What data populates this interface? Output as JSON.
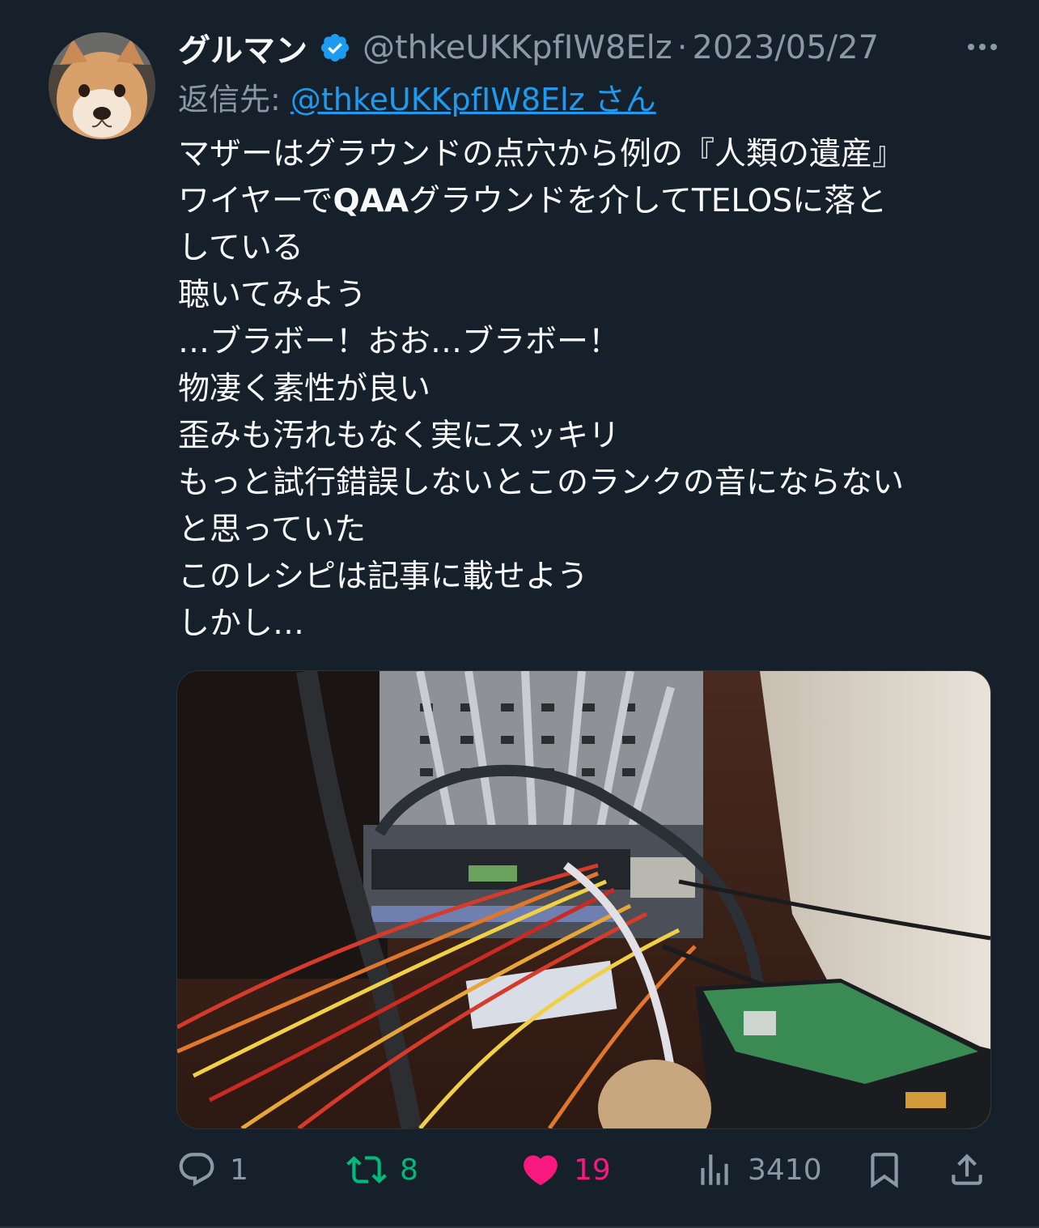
{
  "tweet": {
    "display_name": "グルマン",
    "handle": "@thkeUKKpfIW8Elz",
    "separator": "·",
    "date": "2023/05/27",
    "reply_prefix": "返信先: ",
    "reply_handle": "@thkeUKKpfIW8Elz さん",
    "lines": {
      "l1": "マザーはグラウンドの点穴から例の『人類の遺産』",
      "l2a": "ワイヤーで",
      "l2b": "QAA",
      "l2c": "グラウンドを介して",
      "l2d": "TELOS",
      "l2e": "に落と",
      "l3": "している",
      "l4": "聴いてみよう",
      "l5": "…ブラボー！おお…ブラボー！",
      "l6": "物凄く素性が良い",
      "l7": "歪みも汚れもなく実にスッキリ",
      "l8": "もっと試行錯誤しないとこのランクの音にならない",
      "l9": "と思っていた",
      "l10": "このレシピは記事に載せよう",
      "l11": "しかし…"
    }
  },
  "actions": {
    "replies": "1",
    "retweets": "8",
    "likes": "19",
    "views": "3410"
  },
  "colors": {
    "background": "#15202b",
    "text": "#f7f9f9",
    "muted": "#8b98a5",
    "link": "#1d9bf0",
    "retweet": "#00ba7c",
    "like": "#f91880"
  },
  "icons": [
    "verified-badge-icon",
    "more-icon",
    "reply-icon",
    "retweet-icon",
    "like-icon",
    "views-icon",
    "bookmark-icon",
    "share-icon"
  ]
}
